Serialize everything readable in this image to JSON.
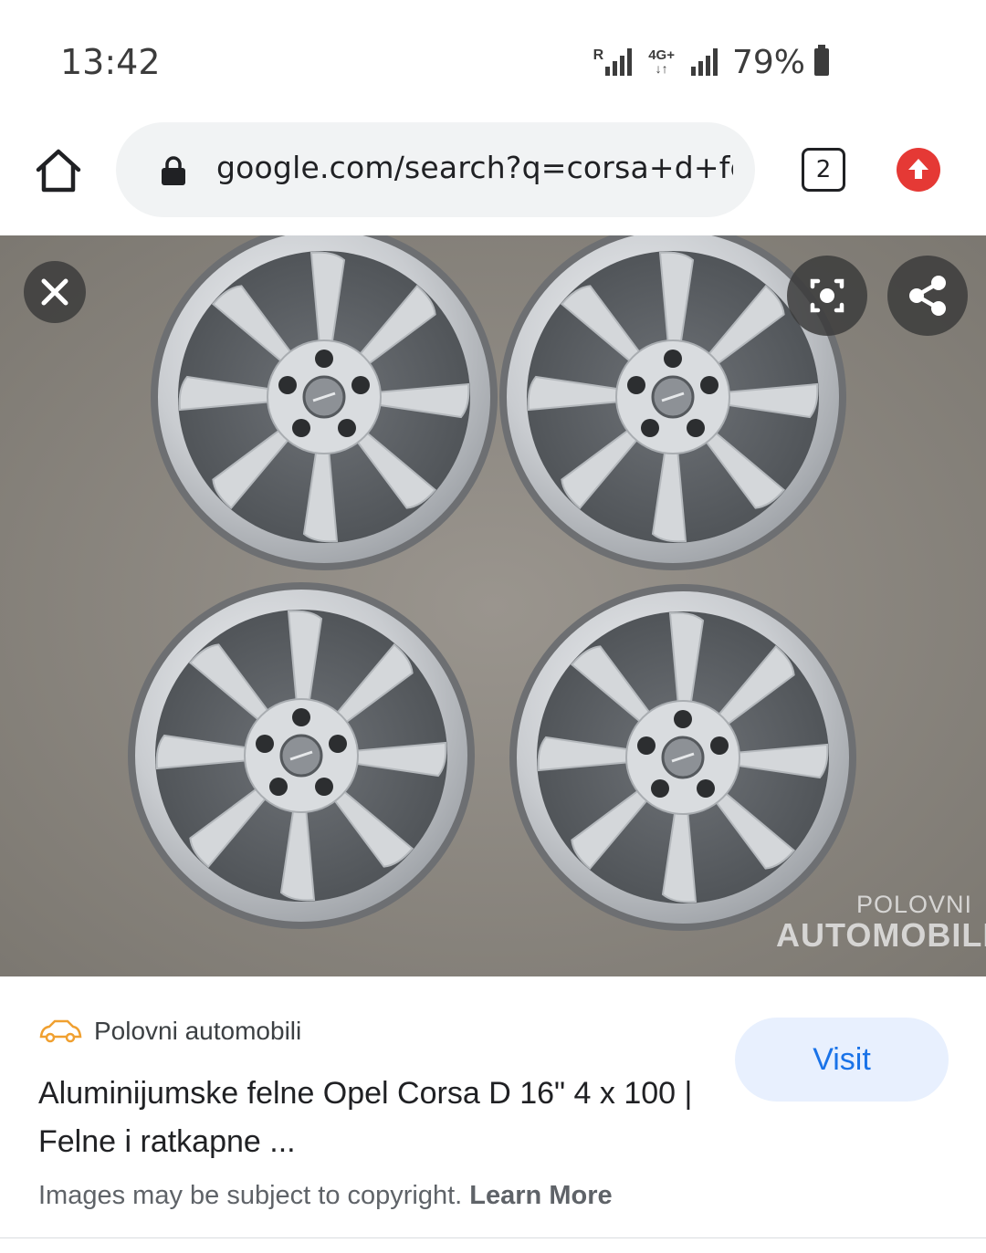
{
  "status_bar": {
    "time": "13:42",
    "roaming_indicator": "R",
    "network_type": "4G+",
    "battery_percent": "79%"
  },
  "browser": {
    "url": "google.com/search?q=corsa+d+felne&",
    "tab_count": "2",
    "icons": {
      "home": "home-icon",
      "lock": "lock-icon",
      "update": "update-arrow-icon"
    },
    "colors": {
      "update": "#e53935",
      "url_bar_bg": "#f1f3f4"
    }
  },
  "image_viewer": {
    "icons": {
      "close": "close-icon",
      "lens": "lens-search-icon",
      "share": "share-icon"
    },
    "watermark": {
      "line1": "POLOVNI",
      "line2": "AUTOMOBILI"
    }
  },
  "result": {
    "source_name": "Polovni automobili",
    "title": "Aluminijumske felne Opel Corsa D 16\" 4 x 100 | Felne i ratkapne ...",
    "visit_label": "Visit",
    "copyright_text": "Images may be subject to copyright.",
    "learn_more_label": "Learn More",
    "colors": {
      "visit_bg": "#e8f0fe",
      "visit_text": "#1a73e8",
      "logo": "#f0a030"
    }
  }
}
